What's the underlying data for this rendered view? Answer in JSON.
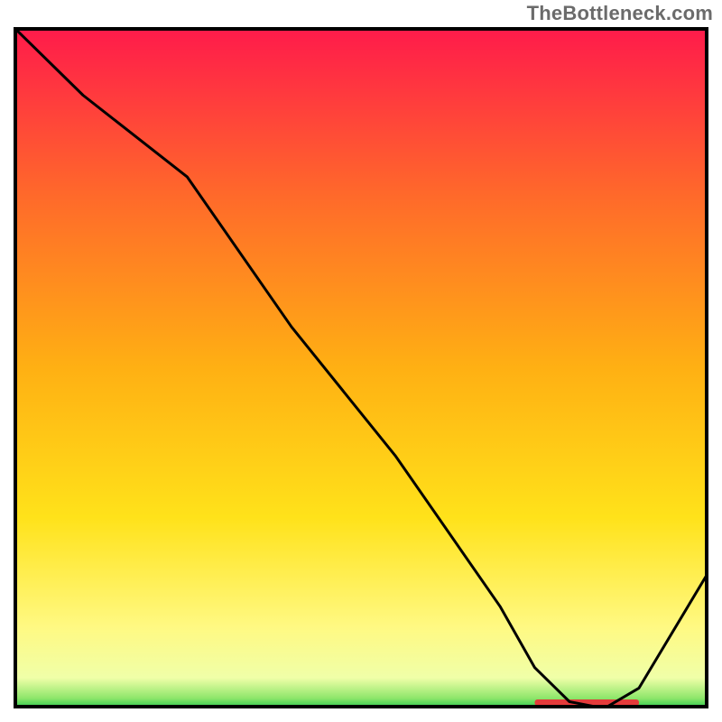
{
  "watermark": "TheBottleneck.com",
  "chart_data": {
    "type": "line",
    "title": "",
    "xlabel": "",
    "ylabel": "",
    "xlim": [
      0,
      100
    ],
    "ylim": [
      0,
      100
    ],
    "grid": false,
    "legend": false,
    "x": [
      0,
      10,
      25,
      40,
      55,
      70,
      75,
      80,
      85,
      90,
      100
    ],
    "values": [
      100,
      90,
      78,
      56,
      37,
      15,
      6,
      1,
      0,
      3,
      20
    ],
    "highlight_segment": {
      "x_start": 75,
      "x_end": 90,
      "color": "#e43b3b"
    },
    "gradient_stops": [
      {
        "offset": 0.0,
        "color": "#ff1a4b"
      },
      {
        "offset": 0.25,
        "color": "#ff6a2a"
      },
      {
        "offset": 0.5,
        "color": "#ffb013"
      },
      {
        "offset": 0.72,
        "color": "#ffe21a"
      },
      {
        "offset": 0.88,
        "color": "#fff982"
      },
      {
        "offset": 0.955,
        "color": "#f0ffa8"
      },
      {
        "offset": 0.985,
        "color": "#8ee66a"
      },
      {
        "offset": 1.0,
        "color": "#27c84e"
      }
    ]
  }
}
